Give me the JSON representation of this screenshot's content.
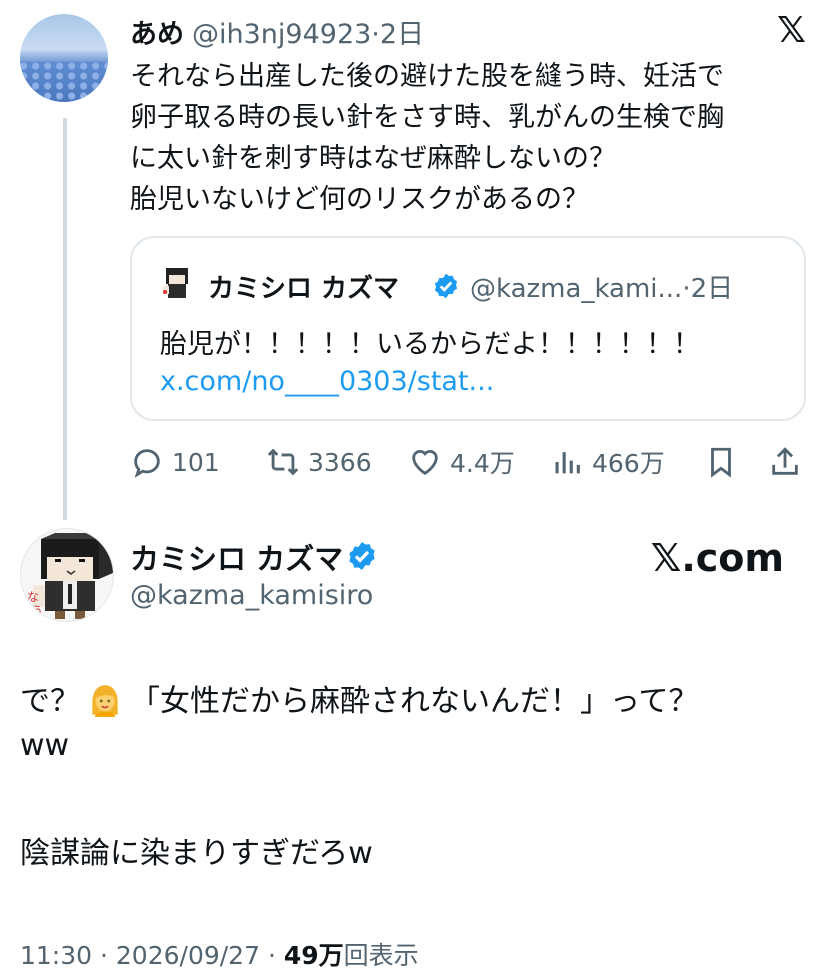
{
  "parent": {
    "name": "あめ",
    "handle": "@ih3nj94923",
    "sep": "·",
    "time": "2日",
    "lines": [
      "それなら出産した後の避けた股を縫う時、妊活で",
      "卵子取る時の長い針をさす時、乳がんの生検で胸",
      "に太い針を刺す時はなぜ麻酔しないの？",
      "胎児いないけど何のリスクがあるの？"
    ],
    "quote": {
      "name": "カミシロ カズマ",
      "handle": "@kazma_kami...",
      "sep": "·",
      "time": "2日",
      "text": "胎児が！！！！！いるからだよ！！！！！！",
      "link": "x.com/no____0303/stat..."
    },
    "actions": {
      "replies": "101",
      "reposts": "3366",
      "likes": "4.4万",
      "views": "466万"
    },
    "brand_logo": "𝕏"
  },
  "main": {
    "name": "カミシロ カズマ",
    "handle": "@kazma_kamisiro",
    "brand": "𝕏.com",
    "body": {
      "line1_a": "で？",
      "line1_b": "「女性だから麻酔されないんだ！」って？",
      "line2": "ww",
      "line3": "陰謀論に染まりすぎだろw"
    },
    "meta": {
      "time": "11:30",
      "sep1": "·",
      "date": "2026/09/27",
      "sep2": "·",
      "views": "49万",
      "views_suffix": "回表示"
    }
  },
  "colors": {
    "text": "#0f1419",
    "secondary": "#536471",
    "link": "#1d9bf0",
    "verified": "#1d9bf0",
    "border": "#e1e8ed"
  }
}
